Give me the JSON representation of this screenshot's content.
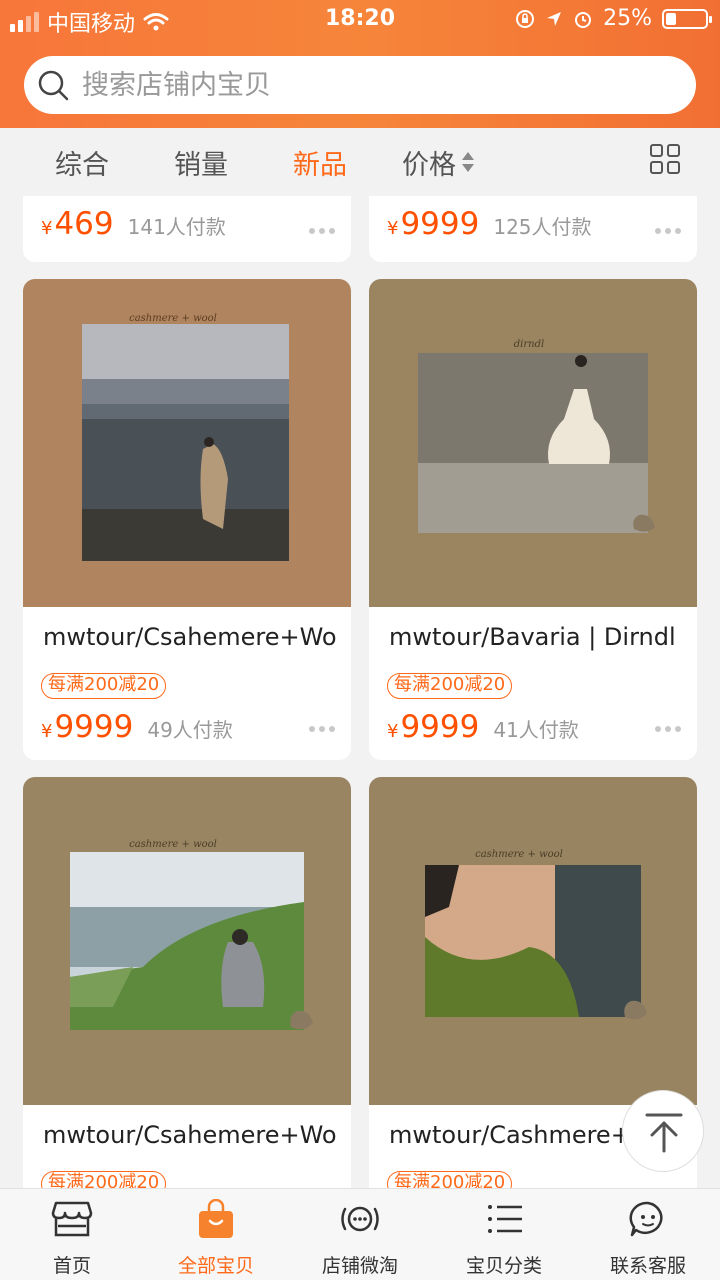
{
  "status_bar": {
    "carrier": "中国移动",
    "time": "18:20",
    "battery_percent": "25%",
    "battery_level": 0.25
  },
  "search": {
    "placeholder": "搜索店铺内宝贝"
  },
  "sort_tabs": [
    {
      "label": "综合",
      "active": false
    },
    {
      "label": "销量",
      "active": false
    },
    {
      "label": "新品",
      "active": true
    },
    {
      "label": "价格",
      "active": false
    }
  ],
  "partial_row": [
    {
      "currency": "¥",
      "price": "469",
      "sold": "141人付款"
    },
    {
      "currency": "¥",
      "price": "9999",
      "sold": "125人付款"
    }
  ],
  "products": [
    {
      "title": "mwtour/Csahemere+Wo",
      "promo": "每满200减20",
      "currency": "¥",
      "price": "9999",
      "sold": "49人付款",
      "bg": "#b0845e",
      "caption": "cashmere + wool"
    },
    {
      "title": "mwtour/Bavaria | Dirndl |",
      "promo": "每满200减20",
      "currency": "¥",
      "price": "9999",
      "sold": "41人付款",
      "bg": "#9a8560",
      "caption": "dirndl"
    },
    {
      "title": "mwtour/Csahemere+Wo",
      "promo": "每满200减20",
      "bg": "#9a8562",
      "caption": "cashmere + wool"
    },
    {
      "title": "mwtour/Cashmere+Wool",
      "promo": "每满200减20",
      "bg": "#988460",
      "caption": "cashmere + wool"
    }
  ],
  "bottom_nav": [
    {
      "label": "首页",
      "icon": "storefront-icon",
      "active": false
    },
    {
      "label": "全部宝贝",
      "icon": "shopping-bag-icon",
      "active": true
    },
    {
      "label": "店铺微淘",
      "icon": "broadcast-icon",
      "active": false
    },
    {
      "label": "宝贝分类",
      "icon": "list-icon",
      "active": false
    },
    {
      "label": "联系客服",
      "icon": "chat-bubble-icon",
      "active": false
    }
  ],
  "colors": {
    "accent": "#ff6a1a",
    "price": "#ff5000",
    "header_gradient_start": "#f7763a",
    "header_gradient_end": "#f26f33"
  }
}
